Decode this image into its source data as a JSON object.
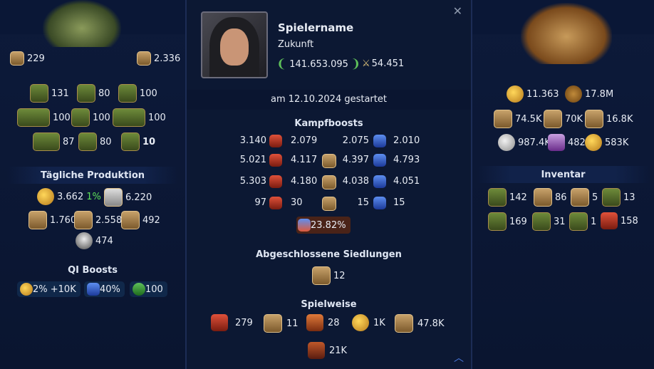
{
  "left": {
    "top_stats": [
      {
        "icon": "land-icon",
        "value": "229"
      },
      {
        "icon": "land-icon",
        "value": "2.336"
      }
    ],
    "buildings": [
      {
        "icon": "building-icon",
        "value": "131"
      },
      {
        "icon": "building-icon",
        "value": "80"
      },
      {
        "icon": "statue-icon",
        "value": "100"
      },
      {
        "icon": "building-icon",
        "value": "100"
      },
      {
        "icon": "building-icon",
        "value": "100"
      },
      {
        "icon": "building-icon",
        "value": "100"
      },
      {
        "icon": "building-icon",
        "value": "87"
      },
      {
        "icon": "building-icon",
        "value": "80"
      },
      {
        "icon": "building-icon",
        "value": "10"
      }
    ],
    "daily_production_title": "Tägliche Produktion",
    "daily": [
      {
        "icon": "coins-icon",
        "value": "3.662",
        "extra": "1%"
      },
      {
        "icon": "supplies-icon",
        "value": "6.220"
      },
      {
        "icon": "goods-icon",
        "value": "1.760"
      },
      {
        "icon": "goods-icon",
        "value": "2.558"
      },
      {
        "icon": "goods-icon",
        "value": "492"
      },
      {
        "icon": "helmet-icon",
        "value": "474"
      }
    ],
    "qi_title": "QI Boosts",
    "qi": [
      {
        "icon": "qi-coins-icon",
        "value": "2% +10K"
      },
      {
        "icon": "qi-attack-icon",
        "value": "40%"
      },
      {
        "icon": "qi-action-icon",
        "value": "100"
      }
    ]
  },
  "center": {
    "player_name": "Spielername",
    "era": "Zukunft",
    "score": "141.653.095",
    "battles": "54.451",
    "started": "am 12.10.2024 gestartet",
    "kampf_title": "Kampfboosts",
    "boost_rows": [
      {
        "a": "3.140",
        "b": "2.079",
        "c": "2.075",
        "d": "2.010"
      },
      {
        "a": "5.021",
        "b": "4.117",
        "c": "4.397",
        "d": "4.793"
      },
      {
        "a": "5.303",
        "b": "4.180",
        "c": "4.038",
        "d": "4.051"
      },
      {
        "a": "97",
        "b": "30",
        "c": "15",
        "d": "15"
      }
    ],
    "boost_total": "23.82%",
    "siedlungen_title": "Abgeschlossene Siedlungen",
    "siedlungen_value": "12",
    "spielweise_title": "Spielweise",
    "spielweise": [
      {
        "icon": "gbg-icon",
        "value": "279"
      },
      {
        "icon": "ge-icon",
        "value": "11"
      },
      {
        "icon": "events-icon",
        "value": "28"
      },
      {
        "icon": "trade-icon",
        "value": "1K"
      },
      {
        "icon": "motivate-icon",
        "value": "47.8K"
      },
      {
        "icon": "fp-icon",
        "value": "21K"
      }
    ]
  },
  "right": {
    "resources": [
      {
        "icon": "coins-icon",
        "value": "11.363"
      },
      {
        "icon": "medal-icon",
        "value": "17.8M"
      },
      {
        "icon": "goods-icon",
        "value": "74.5K"
      },
      {
        "icon": "goods-icon",
        "value": "70K"
      },
      {
        "icon": "goods-icon",
        "value": "16.8K"
      },
      {
        "icon": "silver-icon",
        "value": "987.4K"
      },
      {
        "icon": "gem-icon",
        "value": "482"
      },
      {
        "icon": "gold-coin-icon",
        "value": "583K"
      }
    ],
    "inventar_title": "Inventar",
    "inventory": [
      {
        "icon": "inv-icon",
        "value": "142"
      },
      {
        "icon": "inv-icon",
        "value": "86"
      },
      {
        "icon": "inv-icon",
        "value": "5"
      },
      {
        "icon": "inv-icon",
        "value": "13"
      },
      {
        "icon": "inv-icon",
        "value": "169"
      },
      {
        "icon": "inv-icon",
        "value": "31"
      },
      {
        "icon": "inv-icon",
        "value": "1"
      },
      {
        "icon": "inv-icon",
        "value": "158"
      }
    ]
  }
}
